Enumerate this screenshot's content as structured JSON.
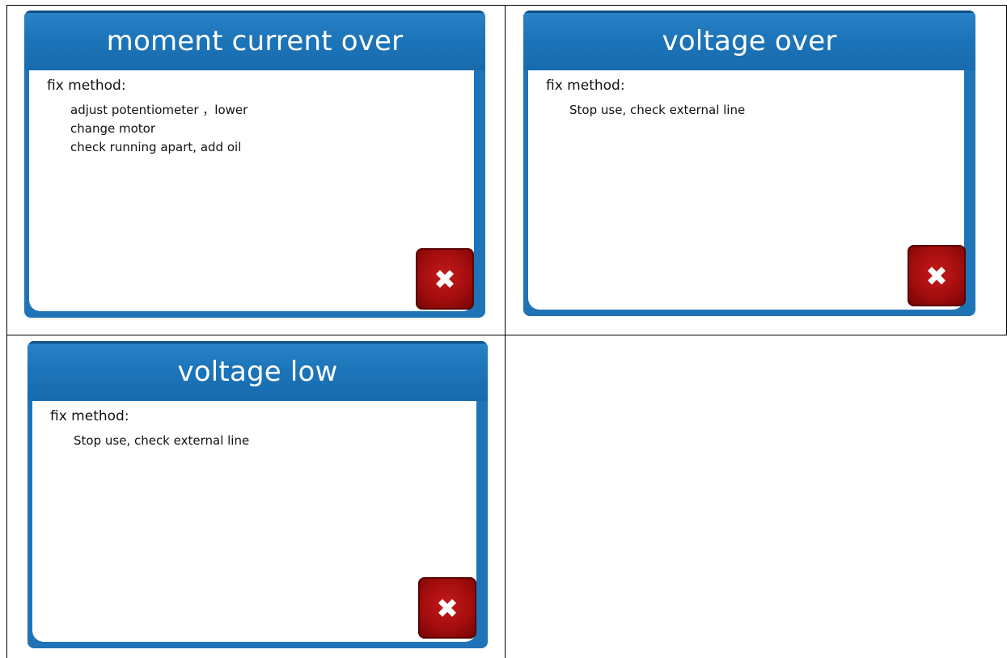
{
  "panels": [
    {
      "title": "moment current over",
      "fix_label": "fix method:",
      "steps": [
        "adjust potentiometer ，lower",
        "change motor",
        "check running apart, add oil"
      ],
      "close_icon": "close-x-icon"
    },
    {
      "title": "voltage over",
      "fix_label": "fix method:",
      "steps": [
        "Stop use, check external line"
      ],
      "close_icon": "close-x-icon"
    },
    {
      "title": "voltage low",
      "fix_label": "fix method:",
      "steps": [
        "Stop use, check external line"
      ],
      "close_icon": "close-x-icon"
    }
  ],
  "colors": {
    "header_blue": "#1f73b7",
    "close_red": "#b01111",
    "text": "#111111"
  }
}
